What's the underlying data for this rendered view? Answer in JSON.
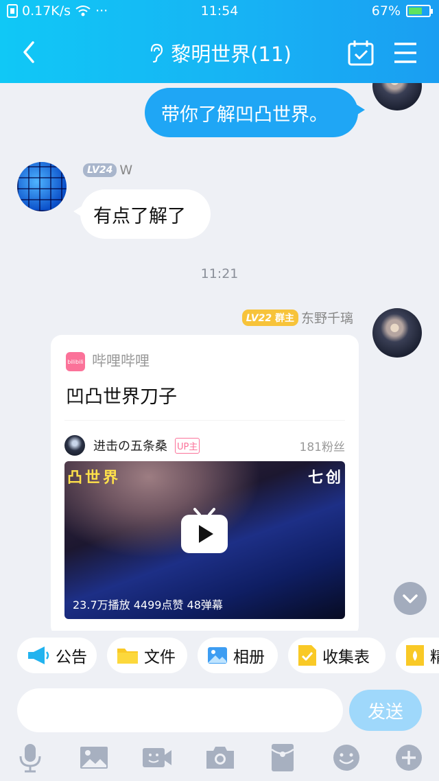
{
  "status_bar": {
    "network_speed": "0.17K/s",
    "time": "11:54",
    "battery": "67%",
    "battery_level": 0.67
  },
  "header": {
    "title": "黎明世界(11)"
  },
  "messages": {
    "outgoing_1": {
      "text": "带你了解凹凸世界。"
    },
    "incoming_1": {
      "level": "LV24",
      "sender": "W",
      "text": "有点了解了"
    },
    "time_separator": "11:21",
    "outgoing_2": {
      "level": "LV22",
      "role": "群主",
      "sender": "东野千璃",
      "share_card": {
        "source": "哔哩哔哩",
        "source_icon_text": "bilibili",
        "title": "凹凸世界刀子",
        "uploader": "进击の五条桑",
        "uploader_tag": "UP主",
        "fans": "181粉丝",
        "video_overlay_left": "凸世界",
        "video_overlay_right": "七创",
        "stats": "23.7万播放  4499点赞  48弹幕"
      }
    }
  },
  "quick_bar": [
    {
      "label": "公告",
      "icon": "megaphone-icon"
    },
    {
      "label": "文件",
      "icon": "folder-icon"
    },
    {
      "label": "相册",
      "icon": "photo-album-icon"
    },
    {
      "label": "收集表",
      "icon": "form-icon"
    },
    {
      "label": "精",
      "icon": "essence-icon"
    }
  ],
  "input": {
    "placeholder": "",
    "send_label": "发送"
  },
  "toolbar_icons": [
    "microphone-icon",
    "image-icon",
    "video-call-icon",
    "camera-icon",
    "red-packet-icon",
    "emoji-icon",
    "plus-icon"
  ],
  "colors": {
    "header_start": "#10c8f6",
    "header_end": "#1a9ef2",
    "bubble_out": "#1fa6f5",
    "send_button": "#9fd8fb"
  }
}
